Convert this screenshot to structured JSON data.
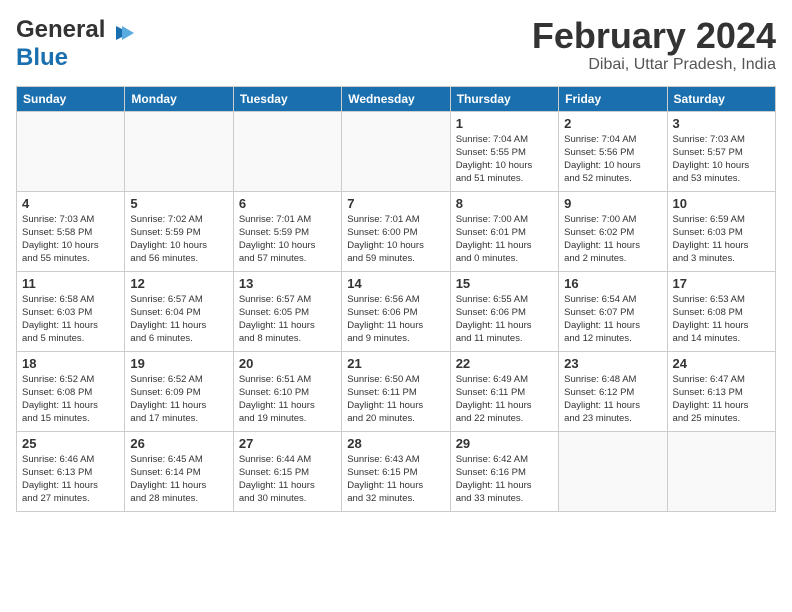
{
  "header": {
    "logo_line1": "General",
    "logo_line2": "Blue",
    "month_title": "February 2024",
    "location": "Dibai, Uttar Pradesh, India"
  },
  "weekdays": [
    "Sunday",
    "Monday",
    "Tuesday",
    "Wednesday",
    "Thursday",
    "Friday",
    "Saturday"
  ],
  "weeks": [
    [
      {
        "day": "",
        "info": ""
      },
      {
        "day": "",
        "info": ""
      },
      {
        "day": "",
        "info": ""
      },
      {
        "day": "",
        "info": ""
      },
      {
        "day": "1",
        "info": "Sunrise: 7:04 AM\nSunset: 5:55 PM\nDaylight: 10 hours\nand 51 minutes."
      },
      {
        "day": "2",
        "info": "Sunrise: 7:04 AM\nSunset: 5:56 PM\nDaylight: 10 hours\nand 52 minutes."
      },
      {
        "day": "3",
        "info": "Sunrise: 7:03 AM\nSunset: 5:57 PM\nDaylight: 10 hours\nand 53 minutes."
      }
    ],
    [
      {
        "day": "4",
        "info": "Sunrise: 7:03 AM\nSunset: 5:58 PM\nDaylight: 10 hours\nand 55 minutes."
      },
      {
        "day": "5",
        "info": "Sunrise: 7:02 AM\nSunset: 5:59 PM\nDaylight: 10 hours\nand 56 minutes."
      },
      {
        "day": "6",
        "info": "Sunrise: 7:01 AM\nSunset: 5:59 PM\nDaylight: 10 hours\nand 57 minutes."
      },
      {
        "day": "7",
        "info": "Sunrise: 7:01 AM\nSunset: 6:00 PM\nDaylight: 10 hours\nand 59 minutes."
      },
      {
        "day": "8",
        "info": "Sunrise: 7:00 AM\nSunset: 6:01 PM\nDaylight: 11 hours\nand 0 minutes."
      },
      {
        "day": "9",
        "info": "Sunrise: 7:00 AM\nSunset: 6:02 PM\nDaylight: 11 hours\nand 2 minutes."
      },
      {
        "day": "10",
        "info": "Sunrise: 6:59 AM\nSunset: 6:03 PM\nDaylight: 11 hours\nand 3 minutes."
      }
    ],
    [
      {
        "day": "11",
        "info": "Sunrise: 6:58 AM\nSunset: 6:03 PM\nDaylight: 11 hours\nand 5 minutes."
      },
      {
        "day": "12",
        "info": "Sunrise: 6:57 AM\nSunset: 6:04 PM\nDaylight: 11 hours\nand 6 minutes."
      },
      {
        "day": "13",
        "info": "Sunrise: 6:57 AM\nSunset: 6:05 PM\nDaylight: 11 hours\nand 8 minutes."
      },
      {
        "day": "14",
        "info": "Sunrise: 6:56 AM\nSunset: 6:06 PM\nDaylight: 11 hours\nand 9 minutes."
      },
      {
        "day": "15",
        "info": "Sunrise: 6:55 AM\nSunset: 6:06 PM\nDaylight: 11 hours\nand 11 minutes."
      },
      {
        "day": "16",
        "info": "Sunrise: 6:54 AM\nSunset: 6:07 PM\nDaylight: 11 hours\nand 12 minutes."
      },
      {
        "day": "17",
        "info": "Sunrise: 6:53 AM\nSunset: 6:08 PM\nDaylight: 11 hours\nand 14 minutes."
      }
    ],
    [
      {
        "day": "18",
        "info": "Sunrise: 6:52 AM\nSunset: 6:08 PM\nDaylight: 11 hours\nand 15 minutes."
      },
      {
        "day": "19",
        "info": "Sunrise: 6:52 AM\nSunset: 6:09 PM\nDaylight: 11 hours\nand 17 minutes."
      },
      {
        "day": "20",
        "info": "Sunrise: 6:51 AM\nSunset: 6:10 PM\nDaylight: 11 hours\nand 19 minutes."
      },
      {
        "day": "21",
        "info": "Sunrise: 6:50 AM\nSunset: 6:11 PM\nDaylight: 11 hours\nand 20 minutes."
      },
      {
        "day": "22",
        "info": "Sunrise: 6:49 AM\nSunset: 6:11 PM\nDaylight: 11 hours\nand 22 minutes."
      },
      {
        "day": "23",
        "info": "Sunrise: 6:48 AM\nSunset: 6:12 PM\nDaylight: 11 hours\nand 23 minutes."
      },
      {
        "day": "24",
        "info": "Sunrise: 6:47 AM\nSunset: 6:13 PM\nDaylight: 11 hours\nand 25 minutes."
      }
    ],
    [
      {
        "day": "25",
        "info": "Sunrise: 6:46 AM\nSunset: 6:13 PM\nDaylight: 11 hours\nand 27 minutes."
      },
      {
        "day": "26",
        "info": "Sunrise: 6:45 AM\nSunset: 6:14 PM\nDaylight: 11 hours\nand 28 minutes."
      },
      {
        "day": "27",
        "info": "Sunrise: 6:44 AM\nSunset: 6:15 PM\nDaylight: 11 hours\nand 30 minutes."
      },
      {
        "day": "28",
        "info": "Sunrise: 6:43 AM\nSunset: 6:15 PM\nDaylight: 11 hours\nand 32 minutes."
      },
      {
        "day": "29",
        "info": "Sunrise: 6:42 AM\nSunset: 6:16 PM\nDaylight: 11 hours\nand 33 minutes."
      },
      {
        "day": "",
        "info": ""
      },
      {
        "day": "",
        "info": ""
      }
    ]
  ]
}
